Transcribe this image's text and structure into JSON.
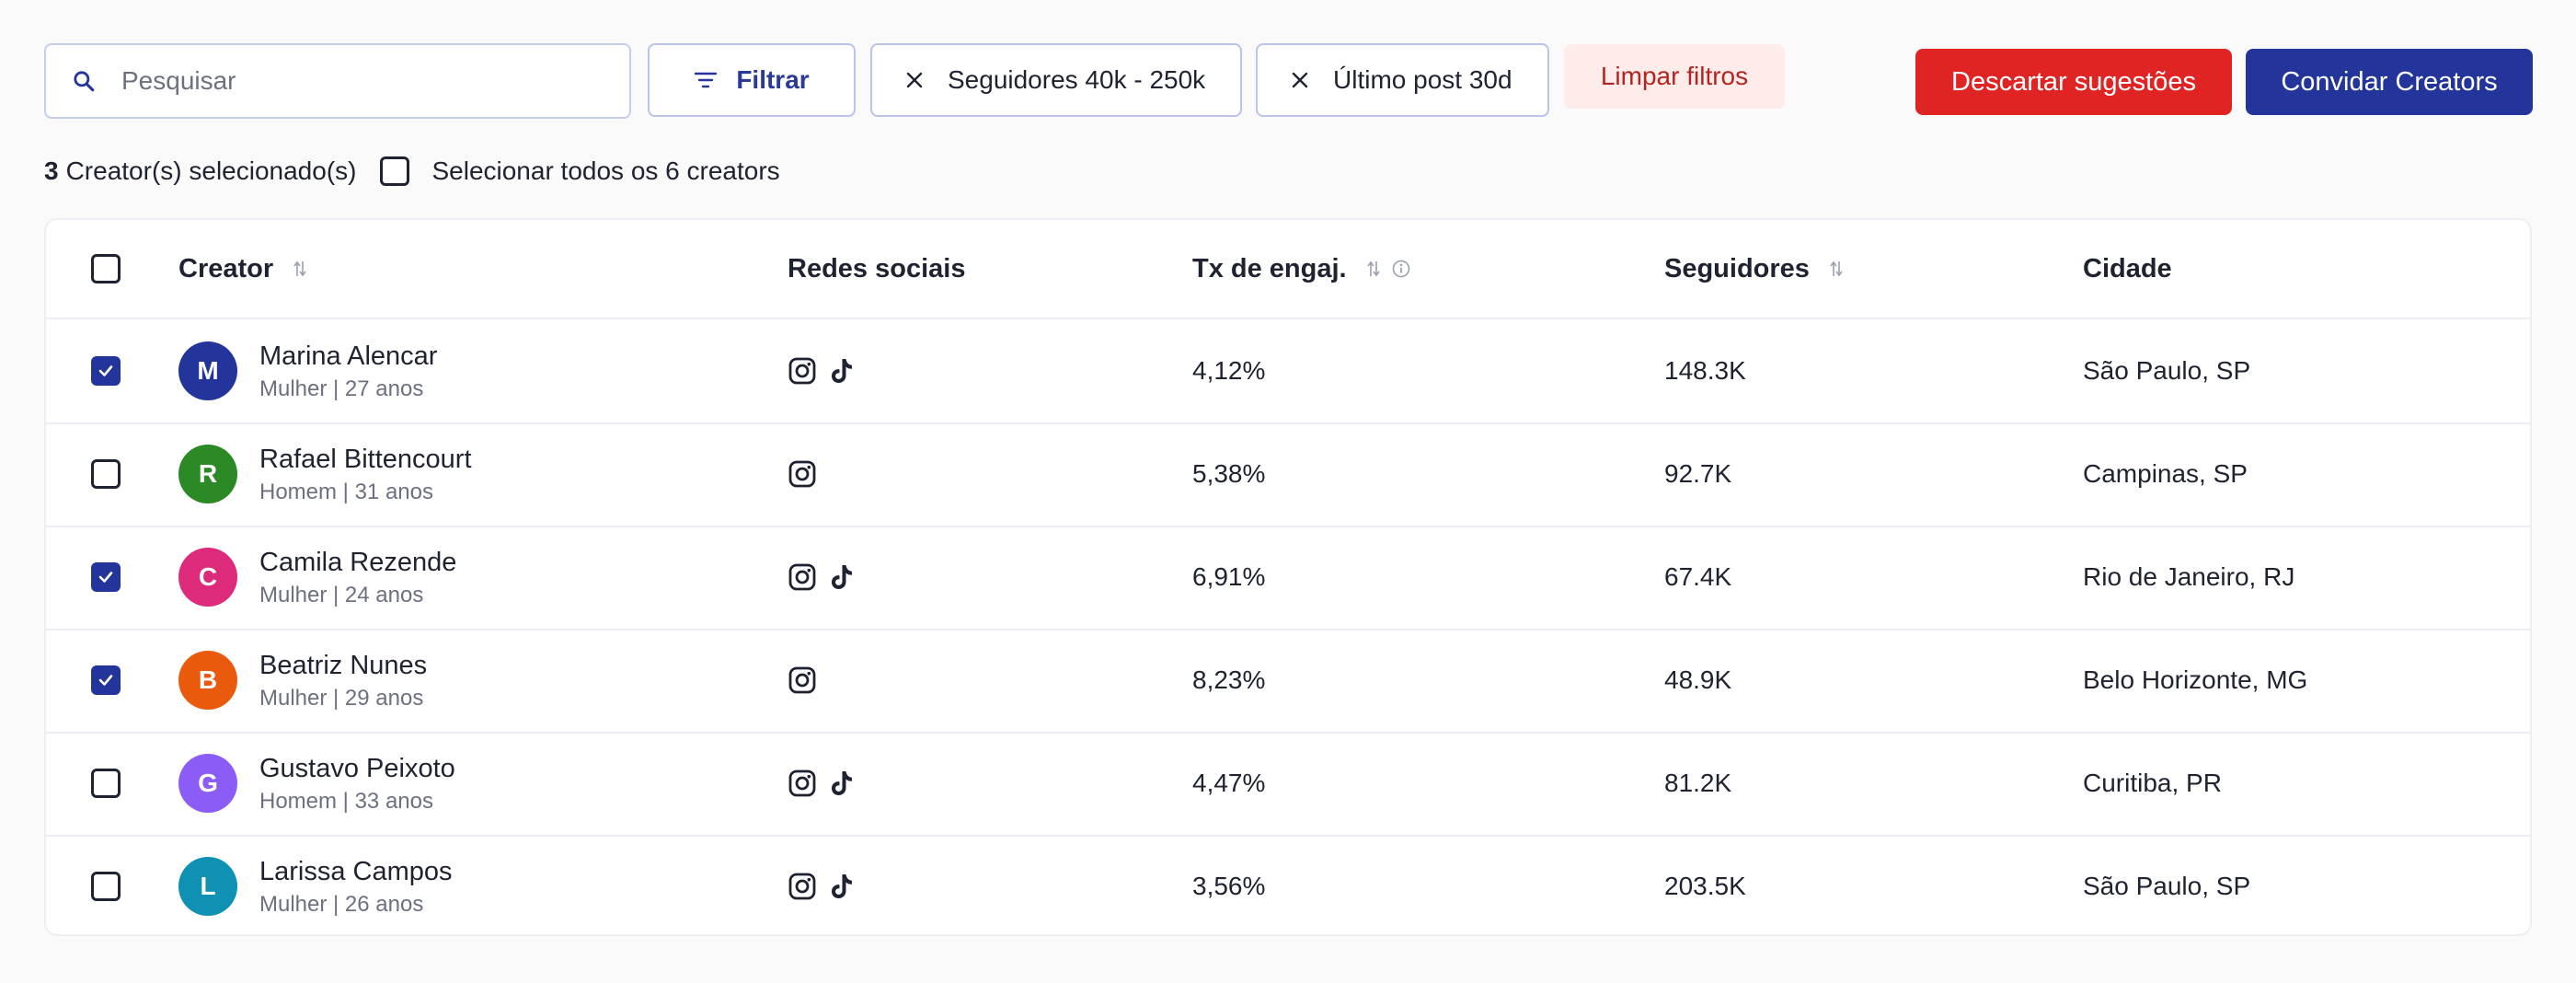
{
  "toolbar": {
    "search_placeholder": "Pesquisar",
    "filter_label": "Filtrar",
    "chips": [
      "Seguidores 40k - 250k",
      "Último post 30d"
    ],
    "clear_label": "Limpar filtros",
    "discard_label": "Descartar sugestões",
    "invite_label": "Convidar Creators"
  },
  "selection": {
    "count": "3",
    "count_text": "Creator(s) selecionado(s)",
    "select_all_label": "Selecionar todos os 6 creators"
  },
  "table": {
    "headers": {
      "creator": "Creator",
      "social": "Redes sociais",
      "engagement": "Tx de engaj.",
      "followers": "Seguidores",
      "city": "Cidade"
    },
    "rows": [
      {
        "initial": "M",
        "color": "#23349a",
        "name": "Marina Alencar",
        "meta": "Mulher | 27 anos",
        "instagram": true,
        "tiktok": true,
        "engagement": "4,12%",
        "followers": "148.3K",
        "city": "São Paulo, SP",
        "checked": true
      },
      {
        "initial": "R",
        "color": "#2b8a25",
        "name": "Rafael Bittencourt",
        "meta": "Homem | 31 anos",
        "instagram": true,
        "tiktok": false,
        "engagement": "5,38%",
        "followers": "92.7K",
        "city": "Campinas, SP",
        "checked": false
      },
      {
        "initial": "C",
        "color": "#dd2a7b",
        "name": "Camila Rezende",
        "meta": "Mulher | 24 anos",
        "instagram": true,
        "tiktok": true,
        "engagement": "6,91%",
        "followers": "67.4K",
        "city": "Rio de Janeiro, RJ",
        "checked": true
      },
      {
        "initial": "B",
        "color": "#ea5a0c",
        "name": "Beatriz Nunes",
        "meta": "Mulher | 29 anos",
        "instagram": true,
        "tiktok": false,
        "engagement": "8,23%",
        "followers": "48.9K",
        "city": "Belo Horizonte, MG",
        "checked": true
      },
      {
        "initial": "G",
        "color": "#8b5cf6",
        "name": "Gustavo Peixoto",
        "meta": "Homem | 33 anos",
        "instagram": true,
        "tiktok": true,
        "engagement": "4,47%",
        "followers": "81.2K",
        "city": "Curitiba, PR",
        "checked": false
      },
      {
        "initial": "L",
        "color": "#0e91b2",
        "name": "Larissa Campos",
        "meta": "Mulher | 26 anos",
        "instagram": true,
        "tiktok": true,
        "engagement": "3,56%",
        "followers": "203.5K",
        "city": "São Paulo, SP",
        "checked": false
      }
    ]
  }
}
